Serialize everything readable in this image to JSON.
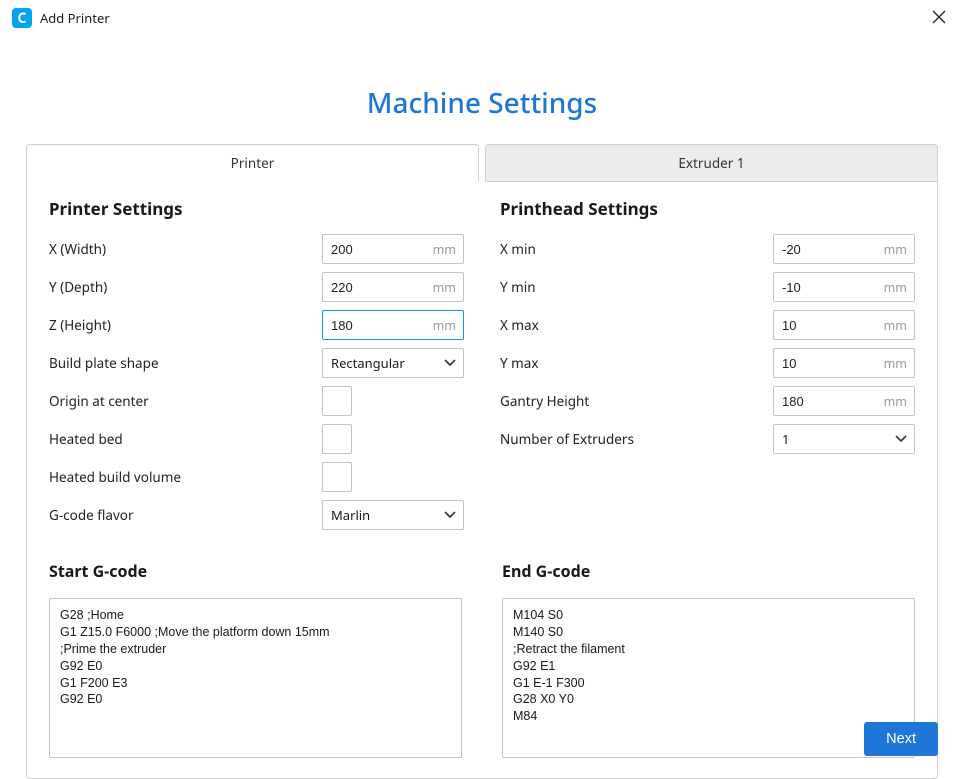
{
  "window": {
    "title": "Add Printer",
    "app_icon_letter": "C"
  },
  "heading": "Machine Settings",
  "tabs": {
    "printer": "Printer",
    "extruder1": "Extruder 1"
  },
  "printer_settings": {
    "heading": "Printer Settings",
    "x_label": "X (Width)",
    "x_value": "200",
    "x_unit": "mm",
    "y_label": "Y (Depth)",
    "y_value": "220",
    "y_unit": "mm",
    "z_label": "Z (Height)",
    "z_value": "180",
    "z_unit": "mm",
    "shape_label": "Build plate shape",
    "shape_value": "Rectangular",
    "origin_label": "Origin at center",
    "heated_bed_label": "Heated bed",
    "heated_vol_label": "Heated build volume",
    "flavor_label": "G-code flavor",
    "flavor_value": "Marlin"
  },
  "printhead_settings": {
    "heading": "Printhead Settings",
    "xmin_label": "X min",
    "xmin_value": "-20",
    "xmin_unit": "mm",
    "ymin_label": "Y min",
    "ymin_value": "-10",
    "ymin_unit": "mm",
    "xmax_label": "X max",
    "xmax_value": "10",
    "xmax_unit": "mm",
    "ymax_label": "Y max",
    "ymax_value": "10",
    "ymax_unit": "mm",
    "gantry_label": "Gantry Height",
    "gantry_value": "180",
    "gantry_unit": "mm",
    "extruders_label": "Number of Extruders",
    "extruders_value": "1"
  },
  "start_gcode": {
    "heading": "Start G-code",
    "content": "G28 ;Home\nG1 Z15.0 F6000 ;Move the platform down 15mm\n;Prime the extruder\nG92 E0\nG1 F200 E3\nG92 E0"
  },
  "end_gcode": {
    "heading": "End G-code",
    "content": "M104 S0\nM140 S0\n;Retract the filament\nG92 E1\nG1 E-1 F300\nG28 X0 Y0\nM84"
  },
  "footer": {
    "next": "Next"
  }
}
